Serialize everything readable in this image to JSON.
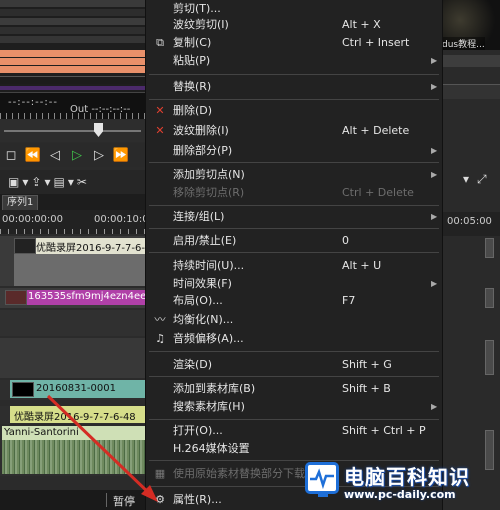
{
  "editor": {
    "timecode_display": "--:--:--:--",
    "out_label": "Out",
    "out_value": "--:--:--:--",
    "sequence_tab": "序列1",
    "timeline_timecode": "00:00:00:00",
    "timeline_timecode2": "00:00:10:00",
    "right_timecode": "00:05:00",
    "clips": {
      "video1": "优酷录屏2016-9-7-7-6-48",
      "pink": "163535sfm9mj4ezn4eeff",
      "teal": "20160831-0001",
      "yellow": "优酷录屏2016-9-7-7-6-48",
      "audio": "Yanni-Santorini"
    },
    "status_text": "暂停",
    "right_caption": "dus教程..."
  },
  "context_menu": {
    "items": [
      {
        "label": "剪切(T)...",
        "shortcut": "",
        "icon": "cut-icon",
        "disabled": false,
        "submenu": false
      },
      {
        "label": "波纹剪切(I)",
        "shortcut": "Alt + X",
        "icon": "",
        "disabled": false,
        "submenu": false
      },
      {
        "label": "复制(C)",
        "shortcut": "Ctrl + Insert",
        "icon": "copy-icon",
        "disabled": false,
        "submenu": false
      },
      {
        "label": "粘贴(P)",
        "shortcut": "",
        "icon": "",
        "disabled": false,
        "submenu": true
      },
      {
        "label": "替换(R)",
        "shortcut": "",
        "icon": "",
        "disabled": false,
        "submenu": true
      },
      {
        "label": "删除(D)",
        "shortcut": "",
        "icon": "delete-icon",
        "disabled": false,
        "submenu": false
      },
      {
        "label": "波纹删除(I)",
        "shortcut": "Alt + Delete",
        "icon": "ripple-delete-icon",
        "disabled": false,
        "submenu": false
      },
      {
        "label": "删除部分(P)",
        "shortcut": "",
        "icon": "",
        "disabled": false,
        "submenu": true
      },
      {
        "label": "添加剪切点(N)",
        "shortcut": "",
        "icon": "",
        "disabled": false,
        "submenu": true
      },
      {
        "label": "移除剪切点(R)",
        "shortcut": "Ctrl + Delete",
        "icon": "",
        "disabled": true,
        "submenu": false
      },
      {
        "label": "连接/组(L)",
        "shortcut": "",
        "icon": "",
        "disabled": false,
        "submenu": true
      },
      {
        "label": "启用/禁止(E)",
        "shortcut": "0",
        "icon": "",
        "disabled": false,
        "submenu": false
      },
      {
        "label": "持续时间(U)...",
        "shortcut": "Alt + U",
        "icon": "",
        "disabled": false,
        "submenu": false
      },
      {
        "label": "时间效果(F)",
        "shortcut": "",
        "icon": "",
        "disabled": false,
        "submenu": true
      },
      {
        "label": "布局(O)...",
        "shortcut": "F7",
        "icon": "",
        "disabled": false,
        "submenu": false
      },
      {
        "label": "均衡化(N)...",
        "shortcut": "",
        "icon": "normalize-icon",
        "disabled": false,
        "submenu": false
      },
      {
        "label": "音频偏移(A)...",
        "shortcut": "",
        "icon": "audio-offset-icon",
        "disabled": false,
        "submenu": false
      },
      {
        "label": "渲染(D)",
        "shortcut": "Shift + G",
        "icon": "",
        "disabled": false,
        "submenu": false
      },
      {
        "label": "添加到素材库(B)",
        "shortcut": "Shift + B",
        "icon": "",
        "disabled": false,
        "submenu": false
      },
      {
        "label": "搜索素材库(H)",
        "shortcut": "",
        "icon": "",
        "disabled": false,
        "submenu": true
      },
      {
        "label": "打开(O)...",
        "shortcut": "Shift + Ctrl + P",
        "icon": "",
        "disabled": false,
        "submenu": false
      },
      {
        "label": "H.264媒体设置",
        "shortcut": "",
        "icon": "",
        "disabled": false,
        "submenu": false
      },
      {
        "label": "使用原始素材替换部分下载",
        "shortcut": "",
        "icon": "replace-icon",
        "disabled": true,
        "submenu": false
      },
      {
        "label": "属性(R)...",
        "shortcut": "",
        "icon": "properties-icon",
        "disabled": false,
        "submenu": false
      }
    ]
  },
  "watermark": {
    "title": "电脑百科知识",
    "url": "www.pc-daily.com"
  },
  "colors": {
    "menu_bg": "#222222",
    "delete_red": "#e04030",
    "play_green": "#41c04b",
    "arrow_red": "#d42c24",
    "watermark_blue": "#1e6fd8"
  }
}
